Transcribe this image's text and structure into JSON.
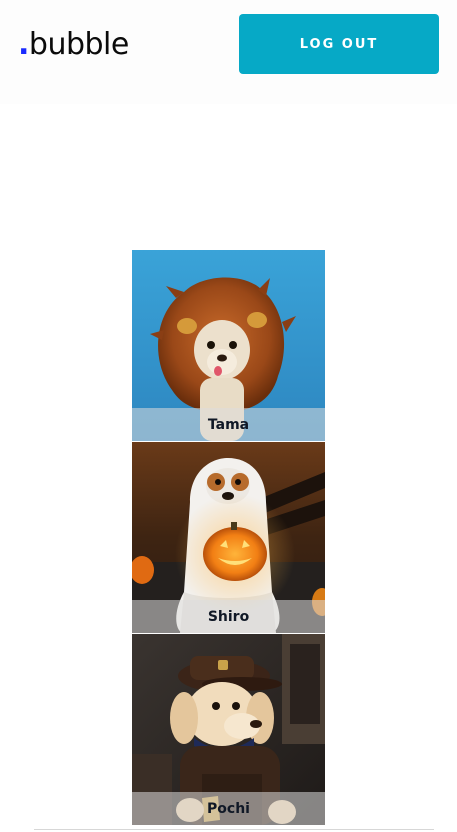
{
  "header": {
    "logo_dot": ".",
    "logo_text": "bubble",
    "logout_label": "LOG OUT"
  },
  "colors": {
    "accent": "#06a9c6",
    "logo_dot": "#1a2bff"
  },
  "pets": [
    {
      "name": "Tama",
      "image": "dog-in-lion-mane-costume"
    },
    {
      "name": "Shiro",
      "image": "dog-in-ghost-costume-with-pumpkin"
    },
    {
      "name": "Pochi",
      "image": "dog-in-delivery-uniform"
    }
  ]
}
